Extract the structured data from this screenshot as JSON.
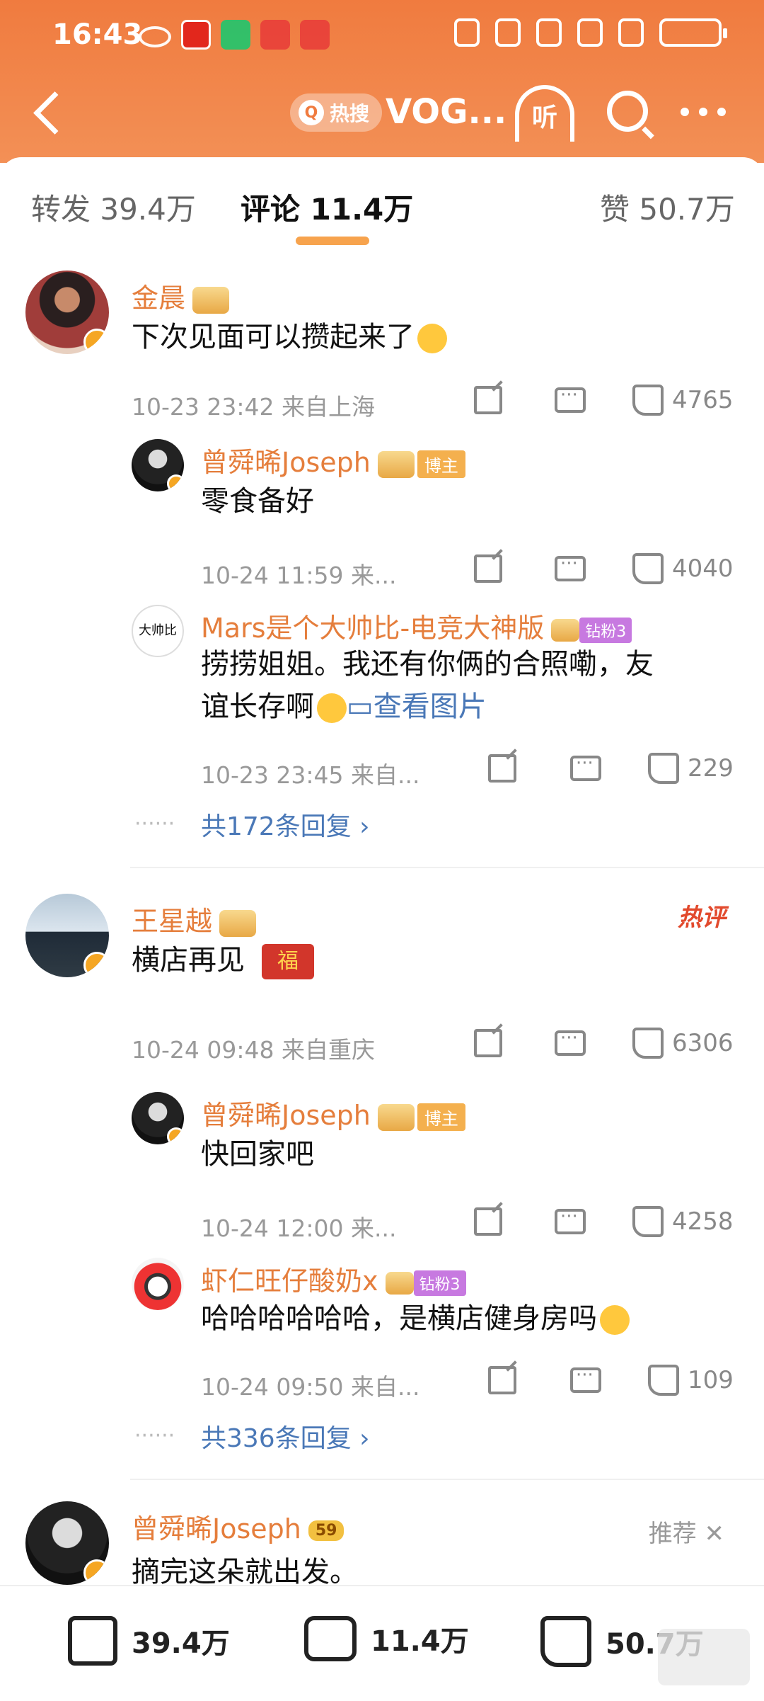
{
  "status": {
    "time": "16:43"
  },
  "nav": {
    "hot_label": "热搜",
    "title": "VOG...",
    "listen_label": "听"
  },
  "tabs": {
    "repost": "转发 39.4万",
    "comments": "评论 11.4万",
    "likes": "赞 50.7万"
  },
  "comments": [
    {
      "user": "金晨",
      "text": "下次见面可以攒起来了",
      "meta": "10-23 23:42 来自上海",
      "likes": "4765",
      "replies": [
        {
          "user": "曾舜晞Joseph",
          "badge": "博主",
          "text": "零食备好",
          "meta": "10-24 11:59 来...",
          "likes": "4040"
        },
        {
          "user": "Mars是个大帅比-电竞大神版",
          "badge": "钻粉3",
          "avatar_text": "大帅比",
          "text_line1": "捞捞姐姐。我还有你俩的合照嘞，友",
          "text_line2": "谊长存啊",
          "pic_link": "查看图片",
          "meta": "10-23 23:45 来自...",
          "likes": "229"
        }
      ],
      "more_replies": "共172条回复 ›"
    },
    {
      "user": "王星越",
      "hot_tag": "热评",
      "text": "横店再见",
      "fu": "福",
      "meta": "10-24 09:48 来自重庆",
      "likes": "6306",
      "replies": [
        {
          "user": "曾舜晞Joseph",
          "badge": "博主",
          "text": "快回家吧",
          "meta": "10-24 12:00 来...",
          "likes": "4258"
        },
        {
          "user": "虾仁旺仔酸奶x",
          "badge": "钻粉3",
          "text": "哈哈哈哈哈哈，是横店健身房吗",
          "meta": "10-24 09:50 来自...",
          "likes": "109"
        }
      ],
      "more_replies": "共336条回复 ›"
    },
    {
      "user": "曾舜晞Joseph",
      "level": "59",
      "rec_tag": "推荐 ✕",
      "text": "摘完这朵就出发。"
    }
  ],
  "bottom": {
    "repost": "39.4万",
    "comments": "11.4万",
    "likes": "50.7万"
  },
  "colors": {
    "header": "#f07b3f",
    "username": "#e57e3c",
    "link": "#4a78b7"
  }
}
